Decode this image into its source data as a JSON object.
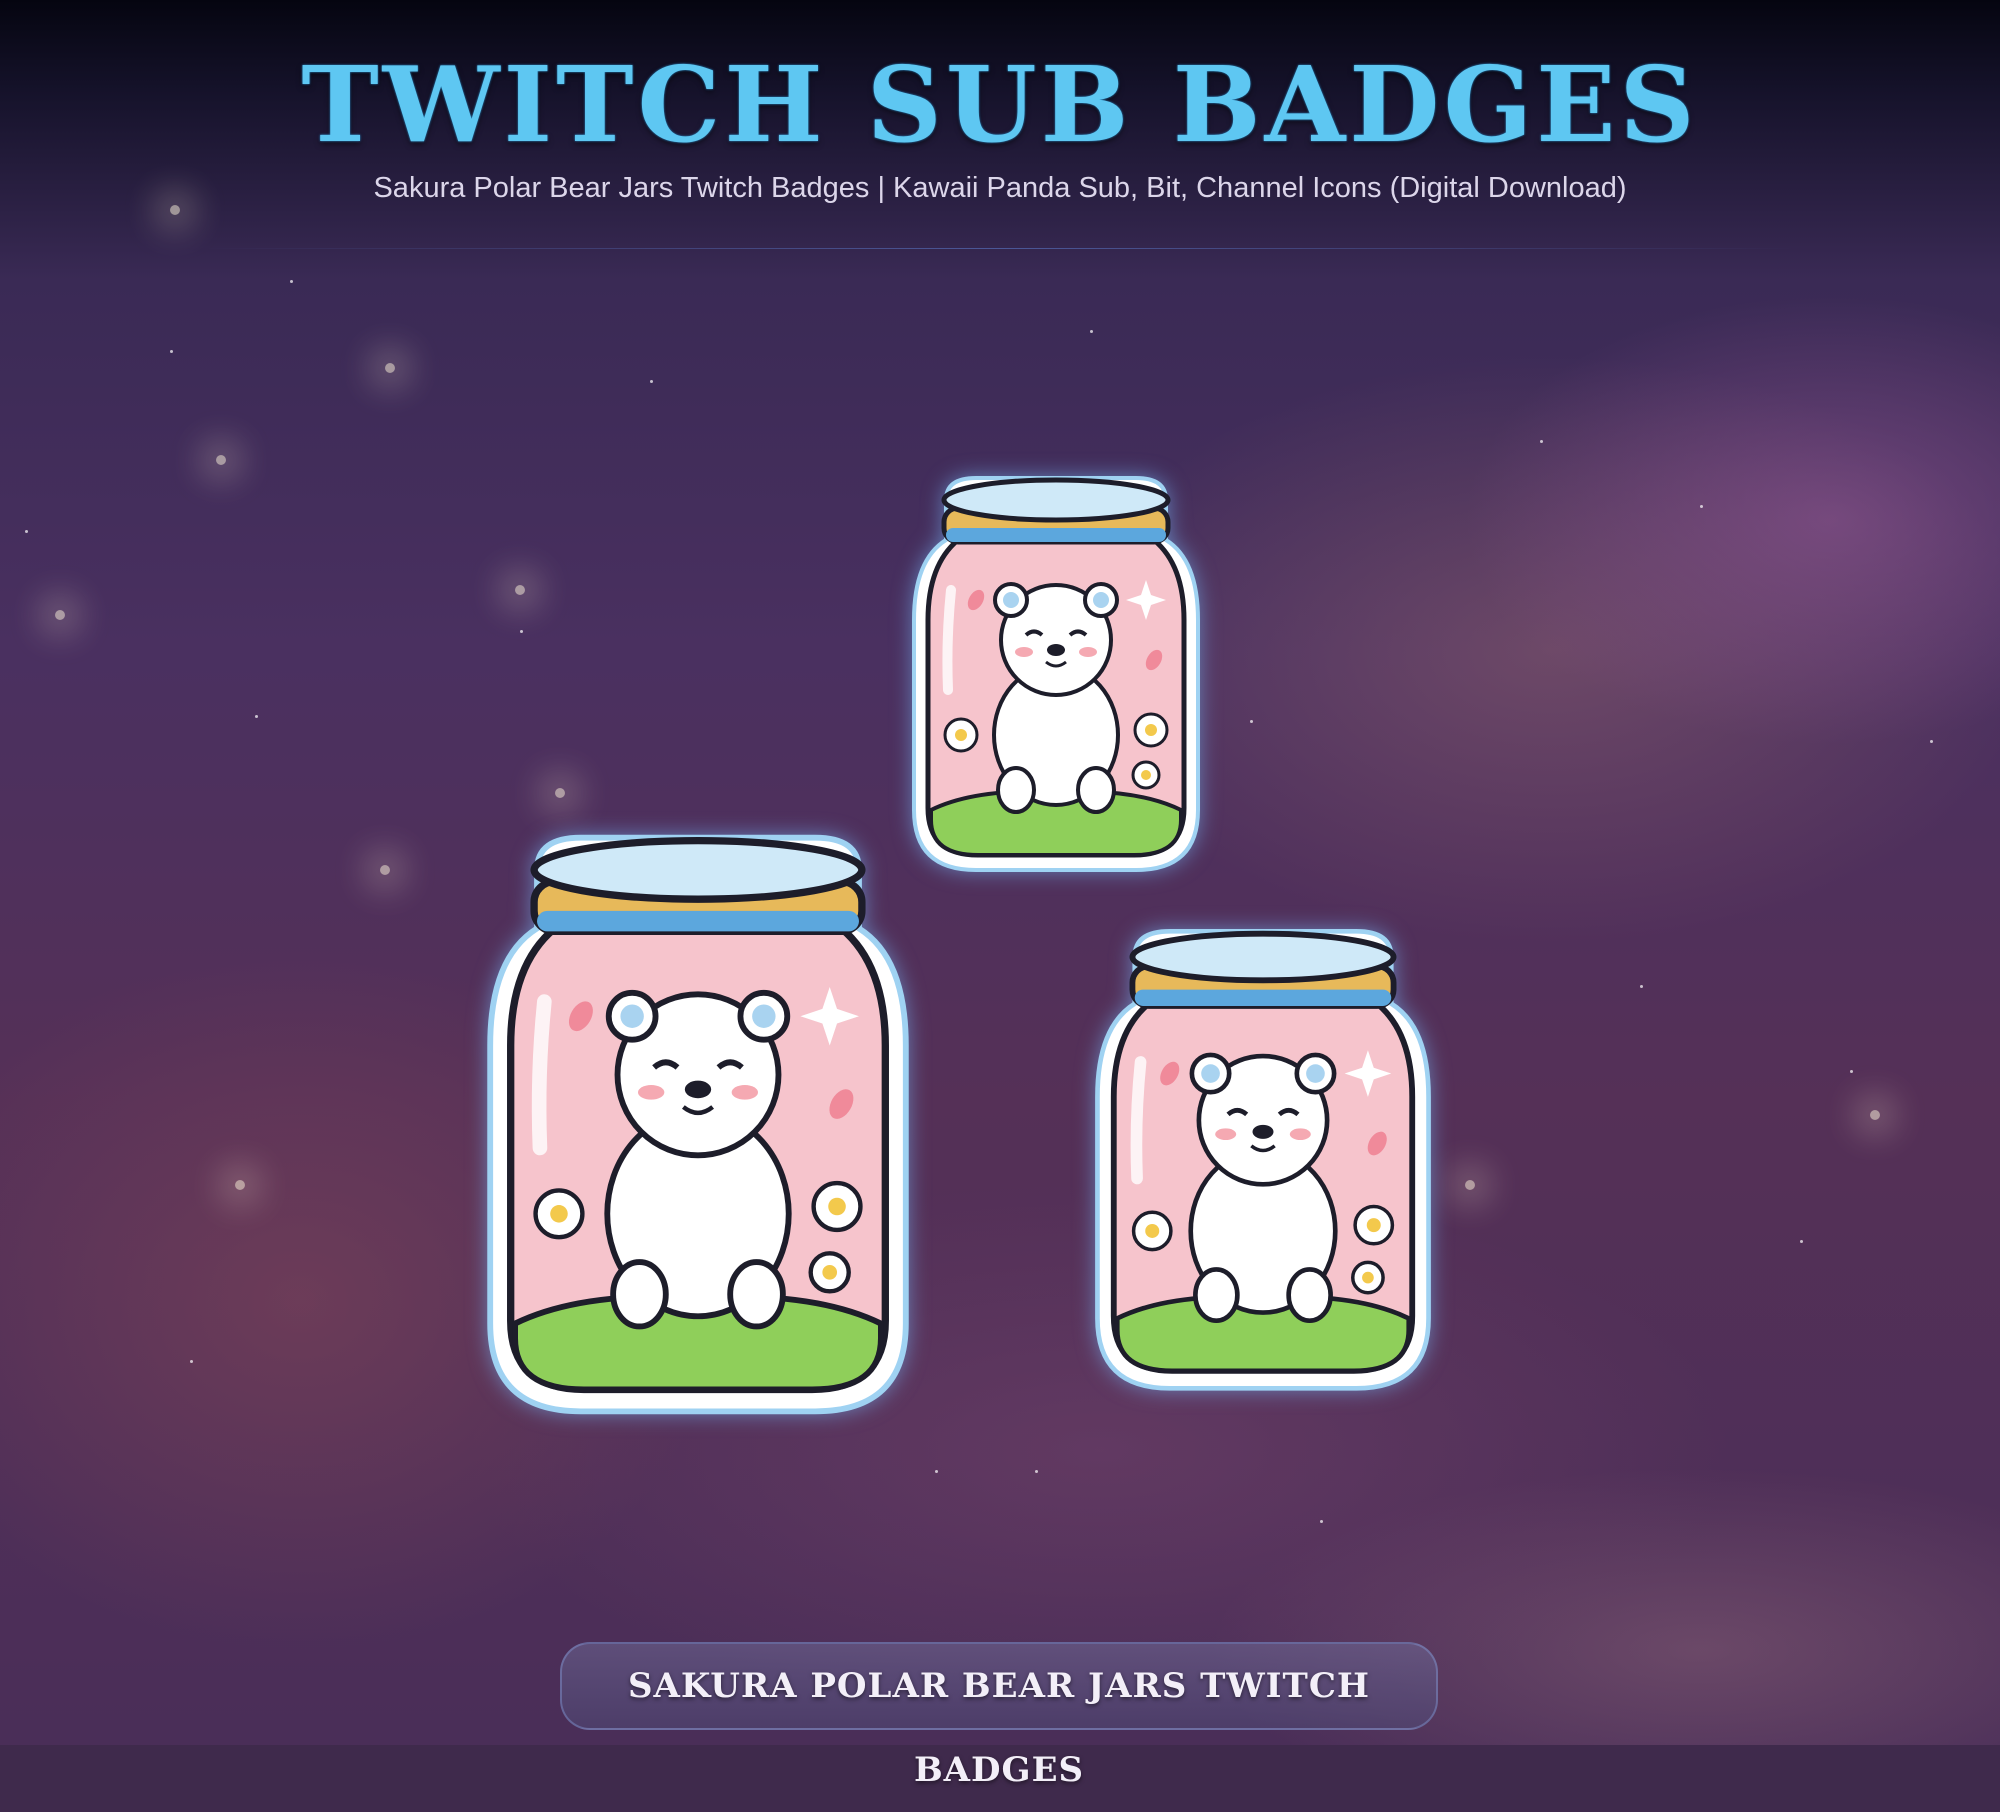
{
  "header": {
    "title": "TWITCH SUB BADGES",
    "subtitle": "Sakura Polar Bear Jars Twitch Badges | Kawaii Panda Sub, Bit, Channel Icons (Digital Download)"
  },
  "badges": [
    {
      "name": "sakura-polar-bear-jar-badge-small"
    },
    {
      "name": "sakura-polar-bear-jar-badge-large"
    },
    {
      "name": "sakura-polar-bear-jar-badge-medium"
    }
  ],
  "footer": {
    "button_label": "SAKURA POLAR BEAR JARS TWITCH BADGES"
  },
  "colors": {
    "title": "#5ec7f2",
    "jar_pink": "#f6c4cc",
    "lid_gold": "#e7b95a",
    "lid_blue": "#5ca7dd",
    "grass": "#8fcf5a"
  }
}
